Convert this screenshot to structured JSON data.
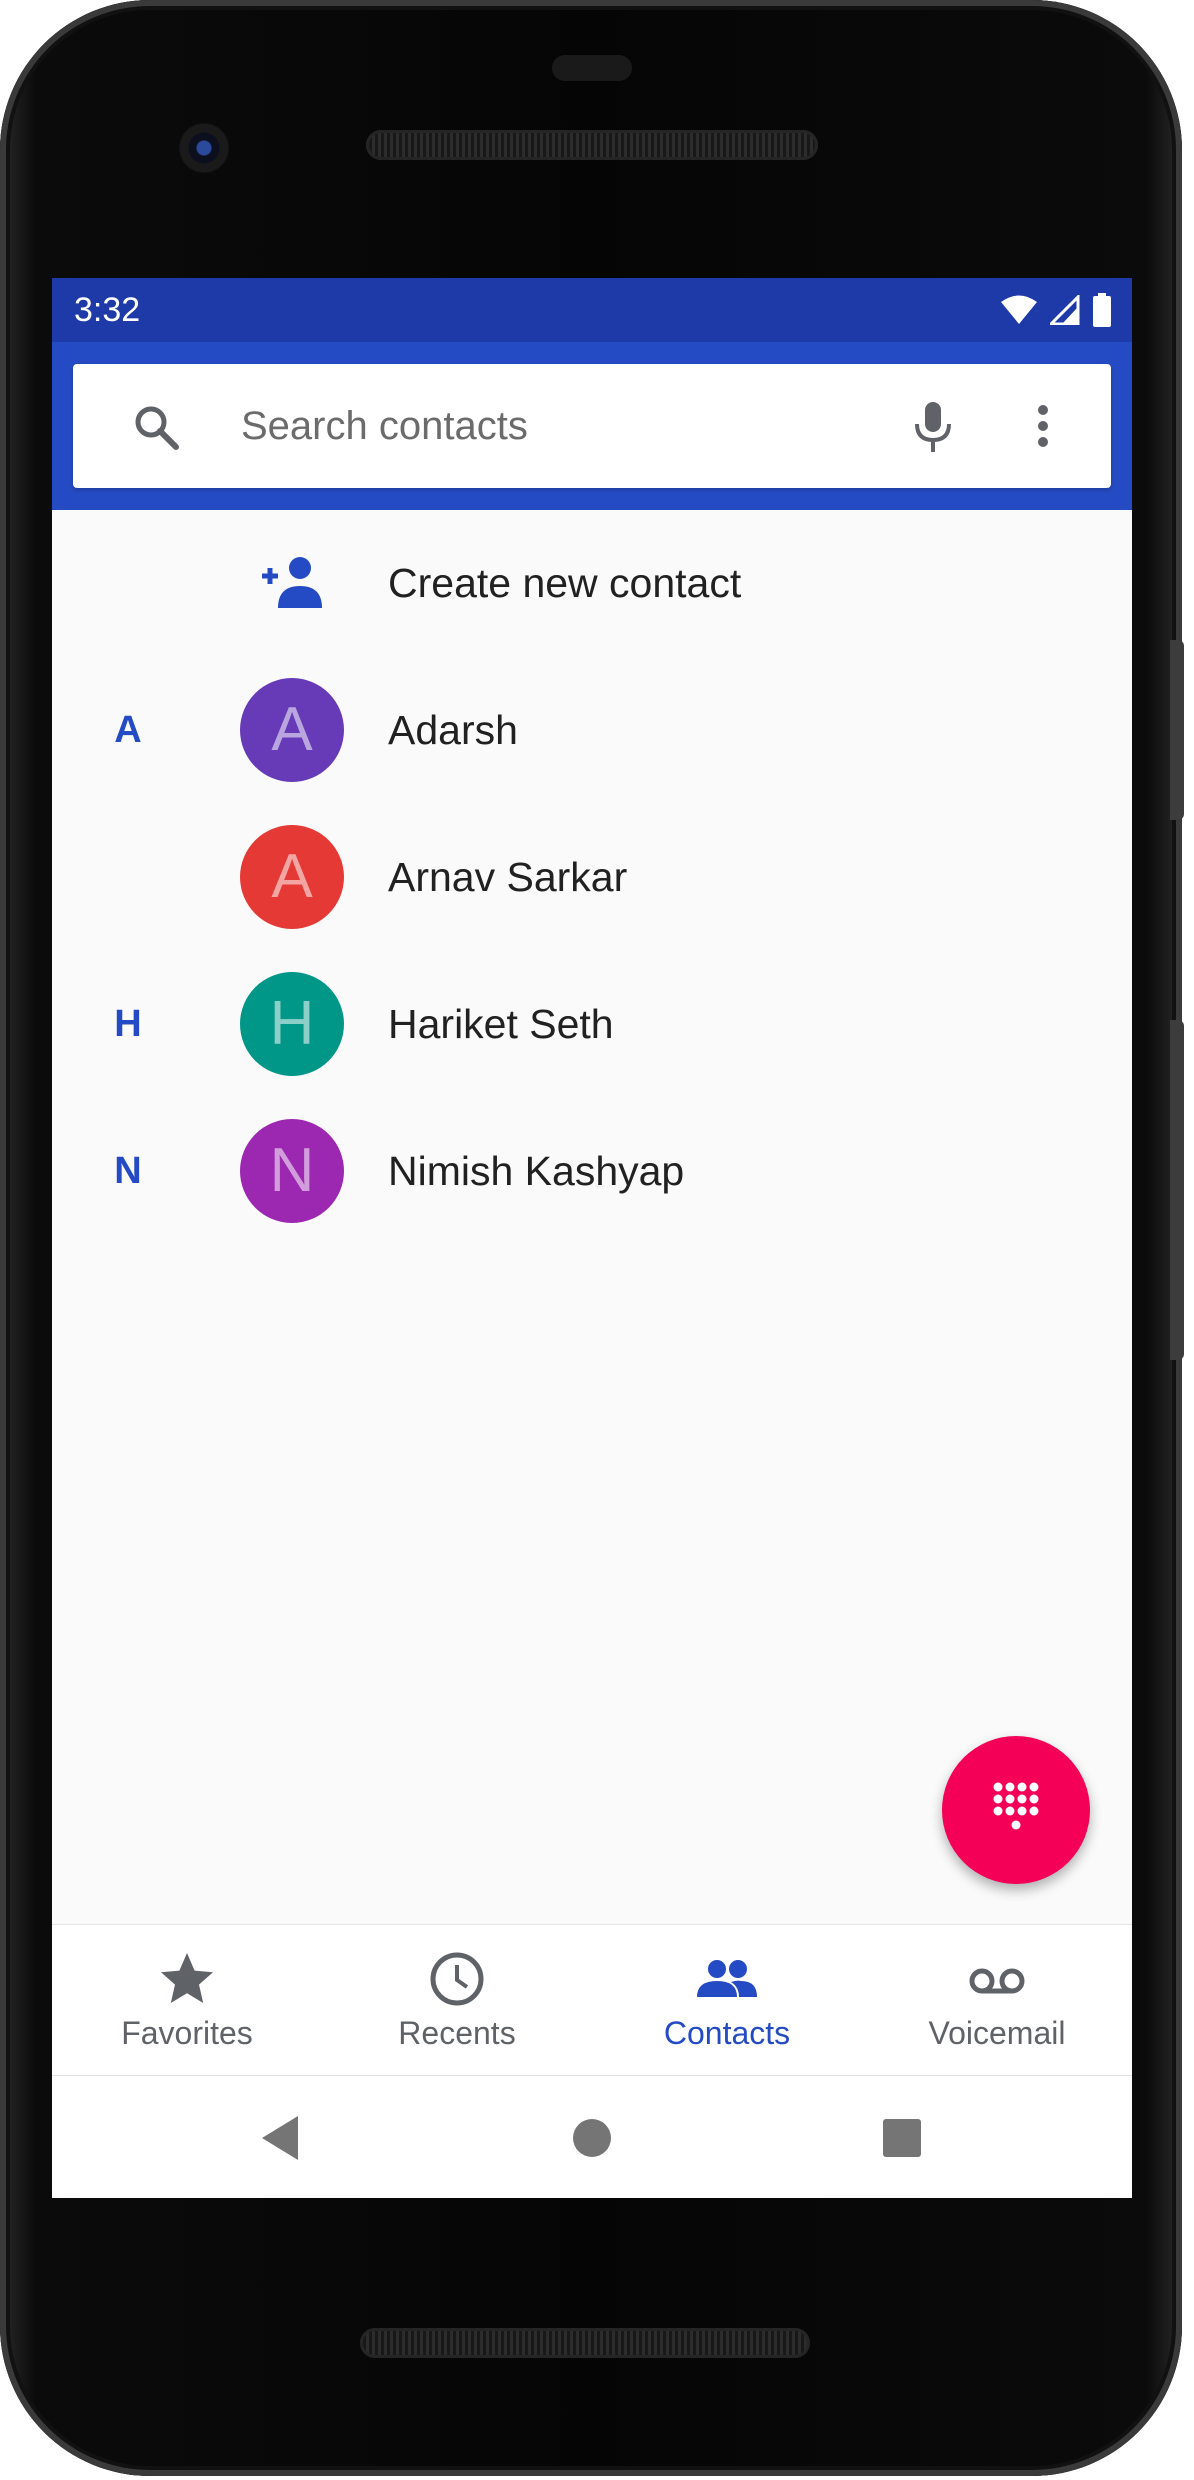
{
  "status_bar": {
    "time": "3:32",
    "icons": [
      "wifi-icon",
      "signal-icon",
      "battery-icon"
    ]
  },
  "search": {
    "placeholder": "Search contacts",
    "icons": [
      "search-icon",
      "mic-icon",
      "more-vert-icon"
    ]
  },
  "create_contact": {
    "label": "Create new contact",
    "icon": "person-add-icon"
  },
  "contacts": [
    {
      "section": "A",
      "initial": "A",
      "name": "Adarsh",
      "color": "#673ab7"
    },
    {
      "section": "",
      "initial": "A",
      "name": "Arnav Sarkar",
      "color": "#e53935"
    },
    {
      "section": "H",
      "initial": "H",
      "name": "Hariket Seth",
      "color": "#009688"
    },
    {
      "section": "N",
      "initial": "N",
      "name": "Nimish Kashyap",
      "color": "#9c27b0"
    }
  ],
  "fab": {
    "icon": "dialpad-icon",
    "color": "#f50057"
  },
  "bottom_nav": [
    {
      "label": "Favorites",
      "icon": "star-icon",
      "active": false
    },
    {
      "label": "Recents",
      "icon": "clock-icon",
      "active": false
    },
    {
      "label": "Contacts",
      "icon": "people-icon",
      "active": true
    },
    {
      "label": "Voicemail",
      "icon": "voicemail-icon",
      "active": false
    }
  ],
  "system_nav": [
    "back-icon",
    "home-icon",
    "recents-square-icon"
  ],
  "colors": {
    "status_bar": "#1e3aa8",
    "app_bar": "#254bc4",
    "accent": "#254bc4",
    "fab": "#f50057"
  }
}
